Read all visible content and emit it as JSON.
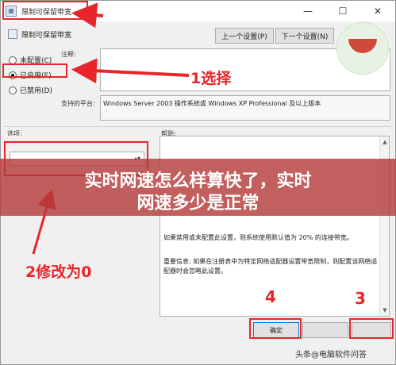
{
  "window": {
    "title": "限制可保留带宽",
    "minimize": "—",
    "maximize": "☐",
    "close": "✕"
  },
  "header": {
    "setting_name": "限制可保留带宽",
    "prev_button": "上一个设置(P)",
    "next_button": "下一个设置(N)"
  },
  "radio": {
    "not_configured": "未配置(C)",
    "enabled": "已启用(E)",
    "disabled": "已禁用(D)"
  },
  "labels": {
    "comment": "注释:",
    "supported_on": "支持的平台:",
    "options": "选项:",
    "help": "帮助:"
  },
  "supported_platform": "Windows Server 2003 操作系统或 Windows XP Professional 及以上版本",
  "help": {
    "para1": "如果禁用或未配置此设置，则系统使用默认值为 20% 的连接带宽。",
    "para2": "重要信息: 如果在注册表中为特定网络适配器设置带宽限制，则配置该网络适配器时会忽略此设置。"
  },
  "buttons": {
    "ok": "确定"
  },
  "annotations": {
    "select": "1选择",
    "change_to_zero": "2修改为0",
    "step_three": "3",
    "step_four": "4"
  },
  "banner": {
    "line1": "实时网速怎么样算快了，实时",
    "line2": "网速多少是正常"
  },
  "watermark": "头条@电脑软件问答",
  "colors": {
    "annotation_red": "#e8262a",
    "banner_bg": "#b43c3c",
    "ok_border": "#0078d7"
  }
}
